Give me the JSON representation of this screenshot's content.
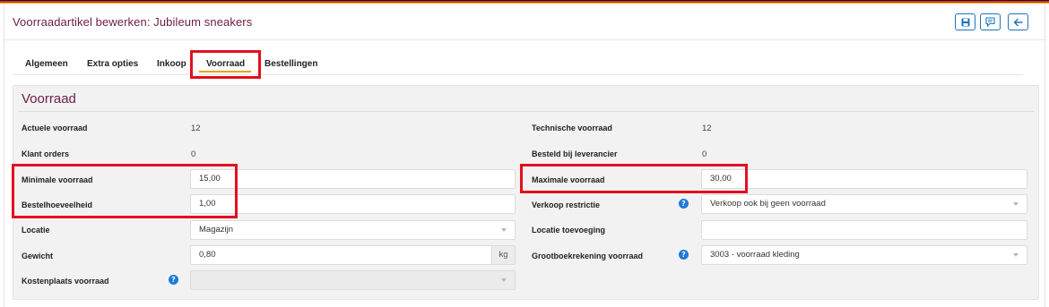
{
  "header": {
    "title": "Voorraadartikel bewerken: Jubileum sneakers",
    "buttons": [
      {
        "icon": "save-icon"
      },
      {
        "icon": "comment-icon"
      },
      {
        "icon": "arrow-left-icon"
      }
    ],
    "accent_color": "#1e73be",
    "title_color": "#6d1b45"
  },
  "tabs": [
    {
      "label": "Algemeen",
      "active": false
    },
    {
      "label": "Extra opties",
      "active": false
    },
    {
      "label": "Inkoop",
      "active": false
    },
    {
      "label": "Voorraad",
      "active": true
    },
    {
      "label": "Bestellingen",
      "active": false
    }
  ],
  "section": {
    "title": "Voorraad",
    "left": {
      "actuele_voorraad": {
        "label": "Actuele voorraad",
        "value": "12"
      },
      "klant_orders": {
        "label": "Klant orders",
        "value": "0"
      },
      "minimale_voorraad": {
        "label": "Minimale voorraad",
        "value": "15,00"
      },
      "bestelhoeveelheid": {
        "label": "Bestelhoeveelheid",
        "value": "1,00"
      },
      "locatie": {
        "label": "Locatie",
        "value": "Magazijn"
      },
      "gewicht": {
        "label": "Gewicht",
        "value": "0,80",
        "unit": "kg"
      },
      "kostenplaats": {
        "label": "Kostenplaats voorraad",
        "value": ""
      }
    },
    "right": {
      "technische_voorraad": {
        "label": "Technische voorraad",
        "value": "12"
      },
      "besteld_bij_leverancier": {
        "label": "Besteld bij leverancier",
        "value": "0"
      },
      "maximale_voorraad": {
        "label": "Maximale voorraad",
        "value": "30,00"
      },
      "verkoop_restrictie": {
        "label": "Verkoop restrictie",
        "value": "Verkoop ook bij geen voorraad"
      },
      "locatie_toevoeging": {
        "label": "Locatie toevoeging",
        "value": ""
      },
      "grootboekrekening": {
        "label": "Grootboekrekening voorraad",
        "value": "3003 - voorraad kleding"
      }
    },
    "help_glyph": "?"
  }
}
